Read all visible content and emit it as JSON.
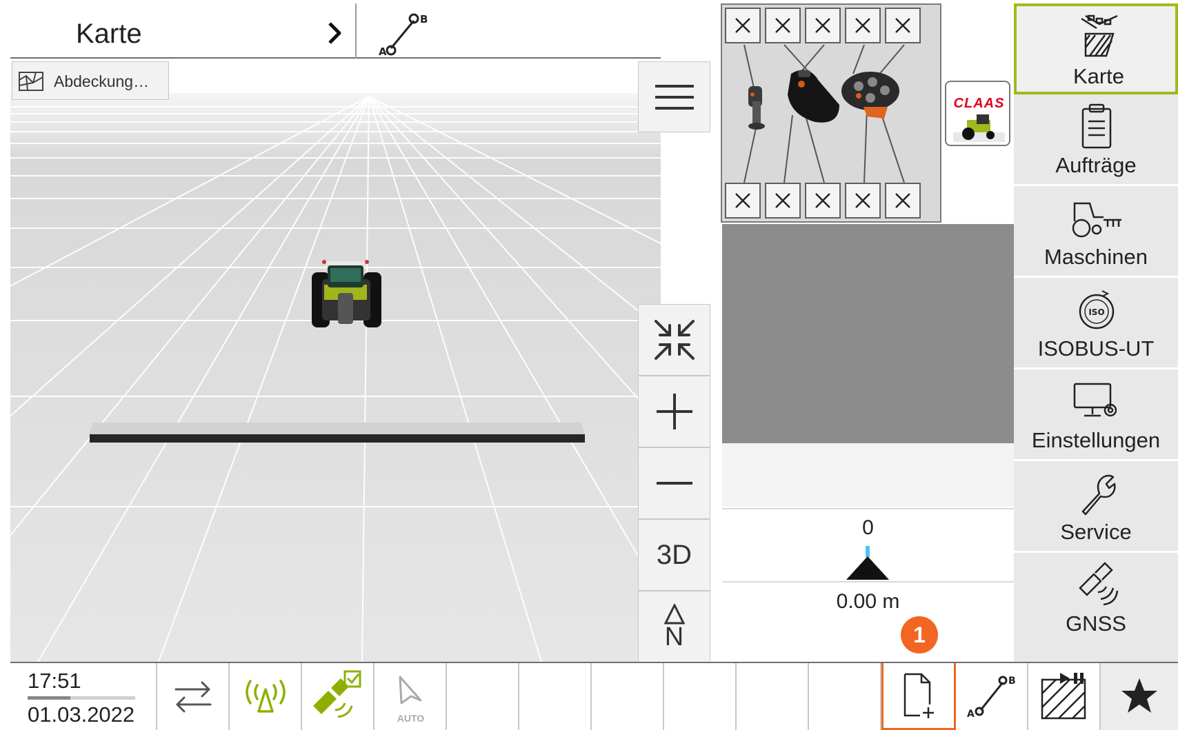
{
  "header": {
    "title": "Karte",
    "chevron_icon": "chevron-right-icon",
    "ab_line_icon": "ab-line-icon"
  },
  "map": {
    "coverage_button_label": "Abdeckung…",
    "coverage_icon": "coverage-map-icon",
    "menu_icon": "hamburger-menu-icon",
    "zoom_fit_icon": "collapse-arrows-icon",
    "zoom_in_icon": "plus-icon",
    "zoom_out_icon": "minus-icon",
    "view_mode_label": "3D",
    "north_label": "N"
  },
  "camera_panel": {
    "close_icon": "close-icon",
    "logo_text": "CLAAS"
  },
  "lightbar": {
    "value": "0",
    "distance": "0.00 m"
  },
  "marker": {
    "number": "1"
  },
  "nav": {
    "items": [
      {
        "label": "Karte",
        "icon": "map-icon",
        "active": true
      },
      {
        "label": "Aufträge",
        "icon": "clipboard-icon",
        "active": false
      },
      {
        "label": "Maschinen",
        "icon": "tractor-implement-icon",
        "active": false
      },
      {
        "label": "ISOBUS-UT",
        "icon": "isobus-icon",
        "active": false
      },
      {
        "label": "Einstellungen",
        "icon": "monitor-gear-icon",
        "active": false
      },
      {
        "label": "Service",
        "icon": "wrench-icon",
        "active": false
      },
      {
        "label": "GNSS",
        "icon": "satellite-icon",
        "active": false
      }
    ]
  },
  "status": {
    "time": "17:51",
    "date": "01.03.2022",
    "auto_label": "AUTO"
  },
  "colors": {
    "accent_green": "#9dbb1c",
    "highlight_orange": "#f26522",
    "claas_red": "#e2001a",
    "lightbar_blue": "#4fc3f7"
  }
}
